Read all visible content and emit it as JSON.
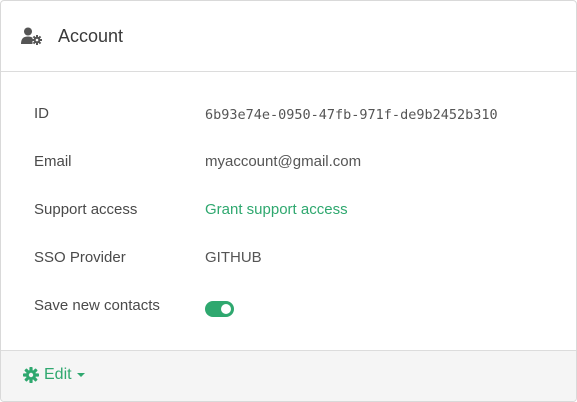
{
  "header": {
    "title": "Account",
    "icon": "user-gear-icon"
  },
  "fields": [
    {
      "label": "ID",
      "value": "6b93e74e-0950-47fb-971f-de9b2452b310"
    },
    {
      "label": "Email",
      "value": "myaccount@gmail.com"
    },
    {
      "label": "Support access",
      "value": "Grant support access"
    },
    {
      "label": "SSO Provider",
      "value": "GITHUB"
    },
    {
      "label": "Save new contacts",
      "toggle_on": true
    }
  ],
  "footer": {
    "edit_label": "Edit",
    "edit_icon": "gear-icon"
  },
  "colors": {
    "accent": "#2fa86f",
    "border": "#d9d9d9",
    "footer_bg": "#f5f5f5"
  }
}
